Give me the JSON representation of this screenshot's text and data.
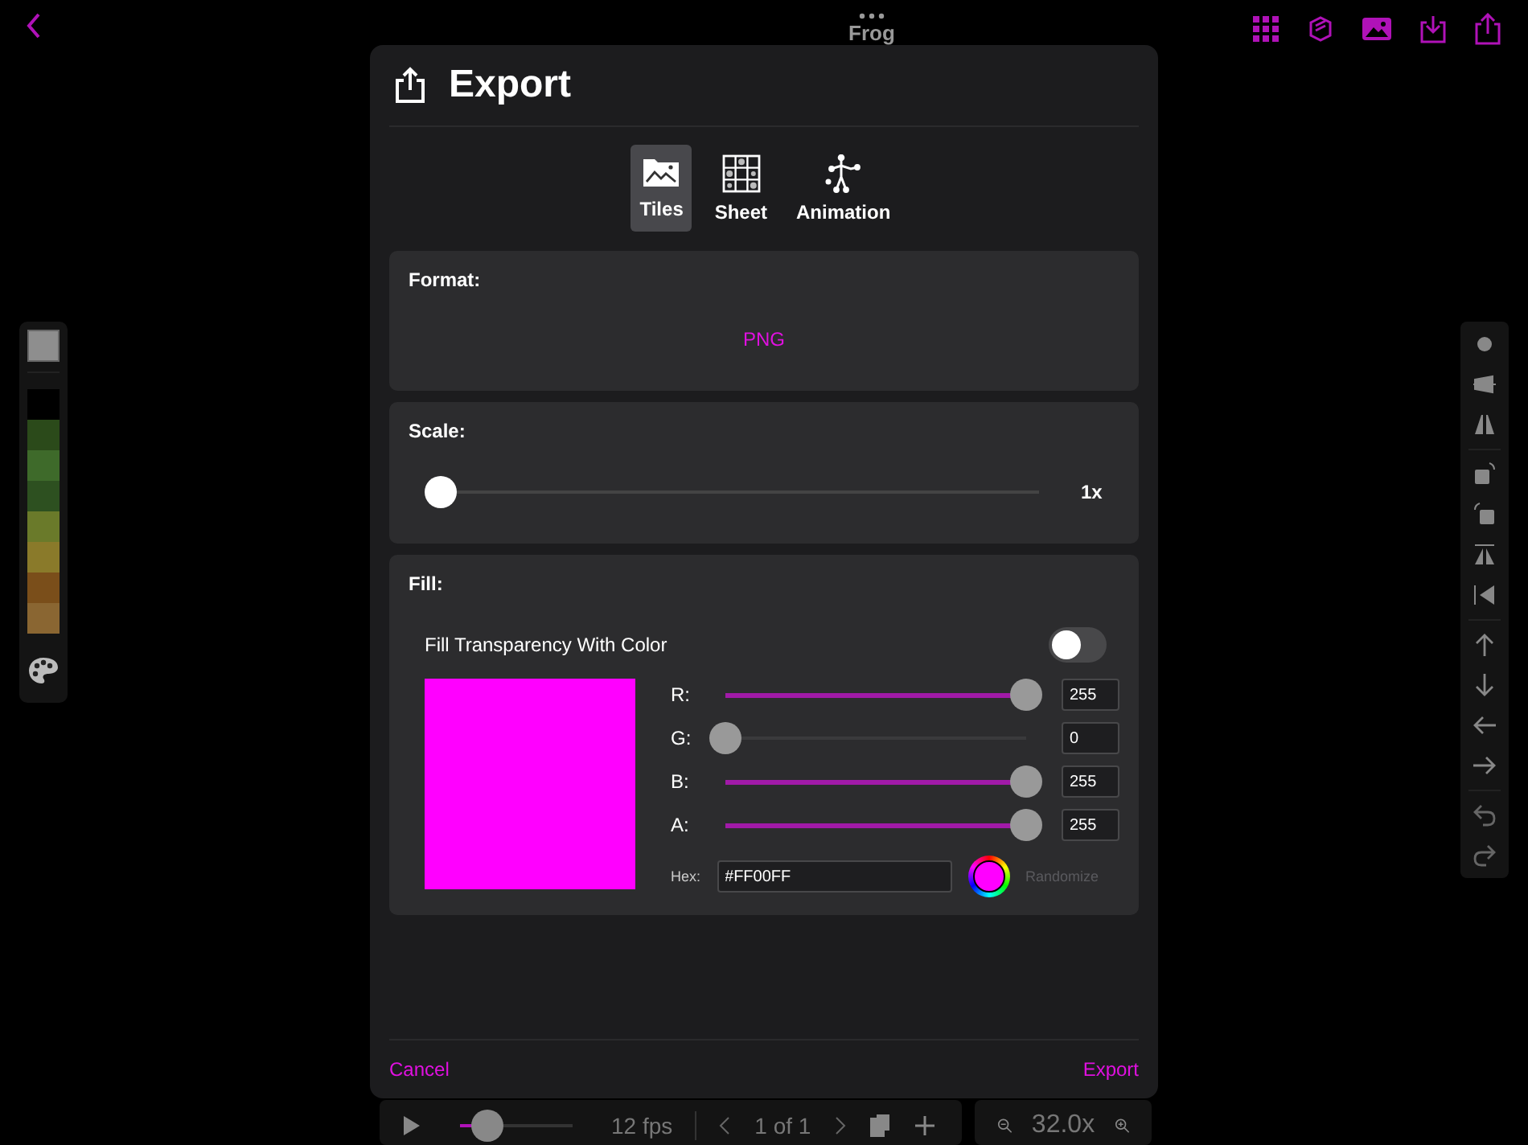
{
  "app": {
    "title": "Frog"
  },
  "palette": [
    {
      "color": "#8e8e8e",
      "selected": true
    },
    {
      "color": "#000000",
      "selected": false
    },
    {
      "color": "#2b4a1a",
      "selected": false
    },
    {
      "color": "#3e6a2a",
      "selected": false
    },
    {
      "color": "#2d5020",
      "selected": false
    },
    {
      "color": "#6a7a2a",
      "selected": false
    },
    {
      "color": "#8a7a2a",
      "selected": false
    },
    {
      "color": "#7a4e1a",
      "selected": false
    },
    {
      "color": "#8a6632",
      "selected": false
    }
  ],
  "playback_bar": {
    "level": 0.24,
    "fps": "12 fps",
    "frame": "1 of 1",
    "zoom": "32.0x"
  },
  "dialog": {
    "title": "Export",
    "tabs": [
      {
        "label": "Tiles",
        "kind": "tiles",
        "selected": true
      },
      {
        "label": "Sheet",
        "kind": "sheet",
        "selected": false
      },
      {
        "label": "Animation",
        "kind": "animation",
        "selected": false
      }
    ],
    "format": {
      "label": "Format:",
      "value": "PNG"
    },
    "scale": {
      "label": "Scale:",
      "level": 0,
      "reading": "1x"
    },
    "fill": {
      "label": "Fill:",
      "toggle_label": "Fill Transparency With Color",
      "on": false,
      "channels": [
        {
          "name": "R:",
          "level": 1,
          "value": "255"
        },
        {
          "name": "G:",
          "level": 0,
          "value": "0"
        },
        {
          "name": "B:",
          "level": 1,
          "value": "255"
        },
        {
          "name": "A:",
          "level": 1,
          "value": "255"
        }
      ],
      "hex_label": "Hex:",
      "hex": "#FF00FF",
      "randomize": "Randomize"
    },
    "cancel": "Cancel",
    "export": "Export"
  }
}
